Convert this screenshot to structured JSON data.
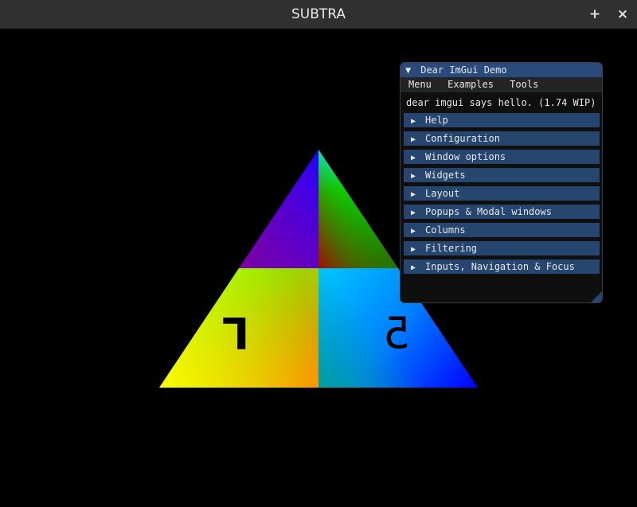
{
  "window": {
    "title": "SUBTRA",
    "add_glyph": "+",
    "close_glyph": "×"
  },
  "scene": {
    "left_digit": "L",
    "right_digit": "5"
  },
  "imgui": {
    "title": "Dear ImGui Demo",
    "collapse_glyph": "▼",
    "menu": [
      "Menu",
      "Examples",
      "Tools"
    ],
    "hello": "dear imgui says hello. (1.74 WIP)",
    "header_glyph": "▶",
    "headers": [
      "Help",
      "Configuration",
      "Window options",
      "Widgets",
      "Layout",
      "Popups & Modal windows",
      "Columns",
      "Filtering",
      "Inputs, Navigation & Focus"
    ]
  }
}
